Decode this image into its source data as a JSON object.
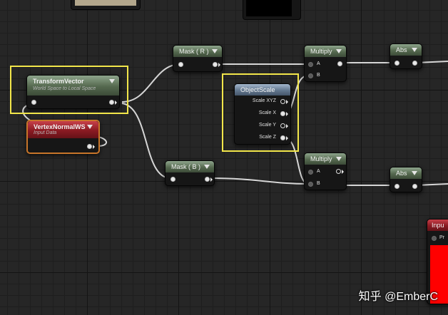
{
  "nodes": {
    "transform_vector": {
      "title": "TransformVector",
      "subtitle": "World Space to Local Space"
    },
    "vertex_normal": {
      "title": "VertexNormalWS",
      "subtitle": "Input Data"
    },
    "mask_r": {
      "title": "Mask ( R )"
    },
    "mask_b": {
      "title": "Mask ( B )"
    },
    "object_scale": {
      "title": "ObjectScale",
      "outputs": [
        "Scale XYZ",
        "Scale X",
        "Scale Y",
        "Scale Z"
      ]
    },
    "multiply_top": {
      "title": "Multiply",
      "input_a": "A",
      "input_b": "B"
    },
    "multiply_bottom": {
      "title": "Multiply",
      "input_a": "A",
      "input_b": "B"
    },
    "abs_top": {
      "title": "Abs"
    },
    "abs_bottom": {
      "title": "Abs"
    },
    "input_partial": {
      "title": "Inpu",
      "pin_label": "Pr"
    }
  },
  "watermark": "知乎 @EmberC",
  "colors": {
    "canvas_bg": "#262626",
    "highlight": "#f2e64a",
    "wire": "#d6d6d6",
    "expression_header": "#55694f",
    "object_header": "#63788f",
    "input_header": "#8a1a22",
    "input_preview": "#ff0000"
  }
}
